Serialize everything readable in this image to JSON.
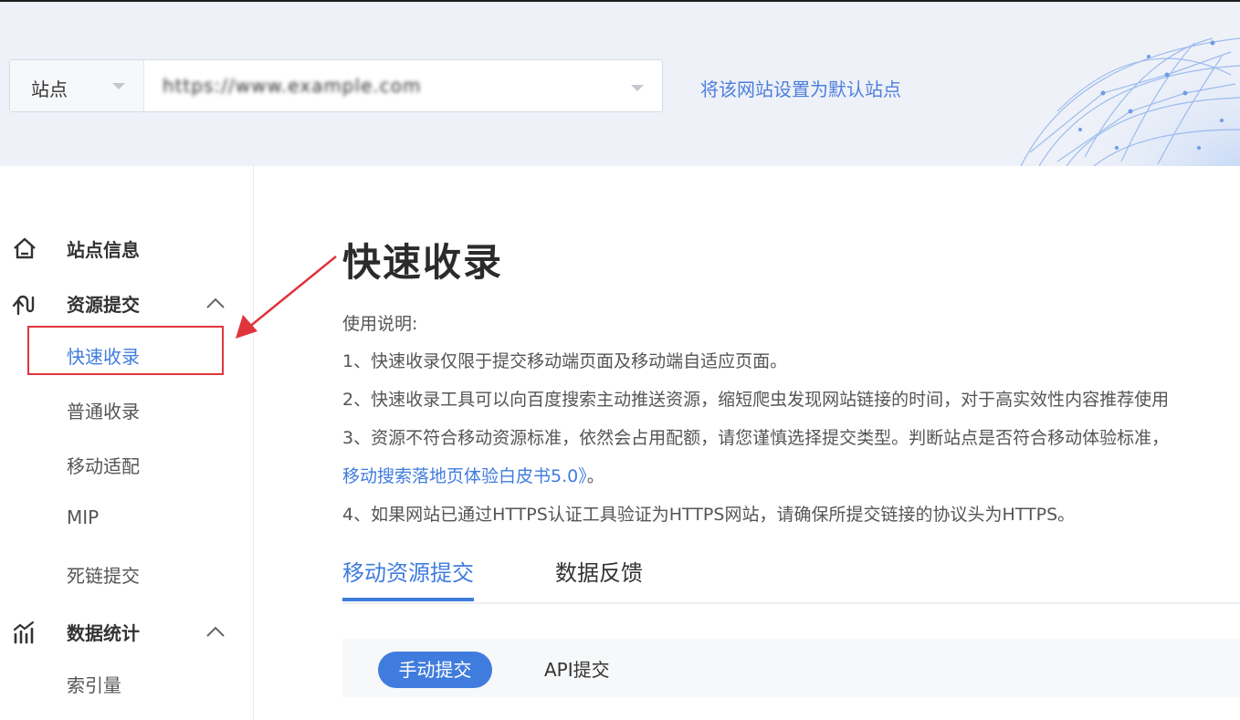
{
  "header": {
    "site_type_label": "站点",
    "site_url_value": "https://www.example.com",
    "set_default_link": "将该网站设置为默认站点"
  },
  "sidebar": {
    "site_info": "站点信息",
    "resource_submit": "资源提交",
    "items_resource": [
      "快速收录",
      "普通收录",
      "移动适配",
      "MIP",
      "死链提交"
    ],
    "data_stats": "数据统计",
    "items_stats": [
      "索引量"
    ]
  },
  "main": {
    "title": "快速收录",
    "instructions": [
      "使用说明:",
      "1、快速收录仅限于提交移动端页面及移动端自适应页面。",
      "2、快速收录工具可以向百度搜索主动推送资源，缩短爬虫发现网站链接的时间，对于高实效性内容推荐使用",
      "3、资源不符合移动资源标准，依然会占用配额，请您谨慎选择提交类型。判断站点是否符合移动体验标准，",
      "移动搜索落地页体验白皮书5.0》",
      "。",
      "4、如果网站已通过HTTPS认证工具验证为HTTPS网站，请确保所提交链接的协议头为HTTPS。"
    ],
    "tabs": [
      "移动资源提交",
      "数据反馈"
    ],
    "submit_modes": [
      "手动提交",
      "API提交"
    ]
  }
}
